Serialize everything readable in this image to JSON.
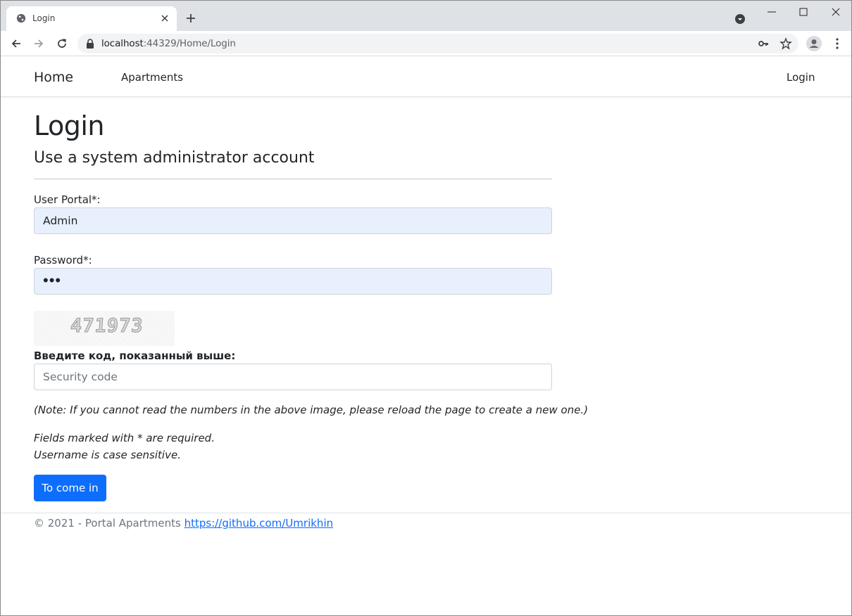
{
  "browser": {
    "tab_title": "Login",
    "url_host": "localhost",
    "url_path": ":44329/Home/Login"
  },
  "icons": {
    "favicon": "globe-icon",
    "tab_close": "close-icon",
    "new_tab": "plus-icon",
    "back": "arrow-left-icon",
    "forward": "arrow-right-icon",
    "reload": "reload-icon",
    "lock": "lock-icon",
    "key": "key-icon",
    "star": "star-icon",
    "profile": "profile-icon",
    "menu": "kebab-menu-icon"
  },
  "navbar": {
    "brand": "Home",
    "links": [
      "Apartments"
    ],
    "login": "Login"
  },
  "main": {
    "title": "Login",
    "subtitle": "Use a system administrator account",
    "user_label": "User Portal*:",
    "user_value": "Admin",
    "password_label": "Password*:",
    "password_mask": "•••",
    "captcha_text": "471973",
    "code_label": "Введите код, показанный выше:",
    "code_placeholder": "Security code",
    "note": "(Note: If you cannot read the numbers in the above image, please reload the page to create a new one.)",
    "required_note": "Fields marked with * are required.",
    "case_note": "Username is case sensitive.",
    "submit_label": "To come in"
  },
  "footer": {
    "text": "© 2021 - Portal Apartments ",
    "link": "https://github.com/Umrikhin"
  },
  "colors": {
    "primary": "#0d6efd",
    "autofill_bg": "#e8f0fe",
    "tabstrip_bg": "#dee1e6"
  }
}
